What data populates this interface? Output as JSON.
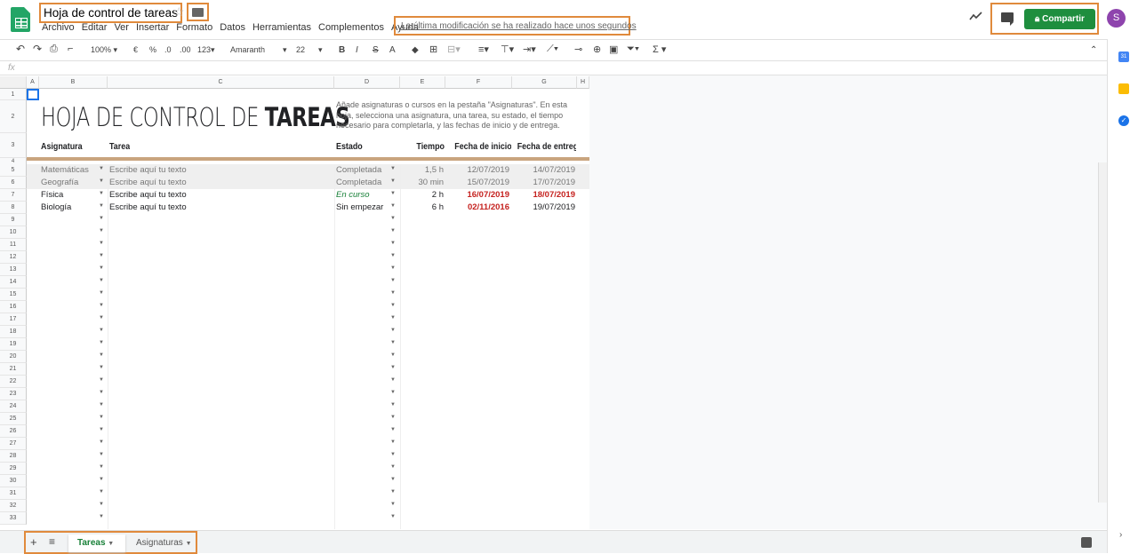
{
  "doc": {
    "title": "Hoja de control de tareas",
    "star": "☆",
    "last_modified": "La última modificación se ha realizado hace unos segundos",
    "share_label": "Compartir",
    "avatar_letter": "S"
  },
  "menu": [
    "Archivo",
    "Editar",
    "Ver",
    "Insertar",
    "Formato",
    "Datos",
    "Herramientas",
    "Complementos",
    "Ayuda"
  ],
  "toolbar": {
    "zoom": "100%",
    "currency": "€",
    "percent": "%",
    "dec_less": ".0",
    "dec_more": ".00",
    "format": "123",
    "font": "Amaranth",
    "font_size": "22",
    "bold": "B",
    "italic": "I",
    "strike": "S",
    "text_color": "A",
    "functions": "Σ"
  },
  "formula_bar": {
    "fx": "fx"
  },
  "columns": [
    "A",
    "B",
    "C",
    "D",
    "E",
    "F",
    "G",
    "H"
  ],
  "rows": [
    "1",
    "2",
    "3",
    "4",
    "5",
    "6",
    "7",
    "8",
    "9",
    "10",
    "11",
    "12",
    "13",
    "14",
    "15",
    "16",
    "17",
    "18",
    "19",
    "20",
    "21",
    "22",
    "23",
    "24",
    "25",
    "26",
    "27",
    "28",
    "29",
    "30",
    "31",
    "32",
    "33"
  ],
  "sheet": {
    "heading_light": "HOJA DE CONTROL DE ",
    "heading_bold": "TAREAS",
    "description": "Añade asignaturas o cursos en la pestaña \"Asignaturas\". En esta hoja, selecciona una asignatura, una tarea, su estado, el tiempo necesario para completarla, y las fechas de inicio y de entrega.",
    "headers": {
      "asignatura": "Asignatura",
      "tarea": "Tarea",
      "estado": "Estado",
      "tiempo": "Tiempo",
      "inicio": "Fecha de inicio",
      "entrega": "Fecha de entrega"
    },
    "tasks": [
      {
        "asignatura": "Matemáticas",
        "tarea": "Escribe aquí tu texto",
        "estado": "Completada",
        "tiempo": "1,5 h",
        "inicio": "12/07/2019",
        "entrega": "14/07/2019"
      },
      {
        "asignatura": "Geografía",
        "tarea": "Escribe aquí tu texto",
        "estado": "Completada",
        "tiempo": "30 min",
        "inicio": "15/07/2019",
        "entrega": "17/07/2019"
      },
      {
        "asignatura": "Física",
        "tarea": "Escribe aquí tu texto",
        "estado": "En curso",
        "tiempo": "2 h",
        "inicio": "16/07/2019",
        "entrega": "18/07/2019"
      },
      {
        "asignatura": "Biología",
        "tarea": "Escribe aquí tu texto",
        "estado": "Sin empezar",
        "tiempo": "6 h",
        "inicio": "02/11/2016",
        "entrega": "19/07/2019"
      }
    ]
  },
  "sheet_tabs": {
    "add": "+",
    "list": "≡",
    "active": "Tareas",
    "other": "Asignaturas"
  },
  "colors": {
    "accent": "#e08a3c",
    "share": "#1e8e3e",
    "overdue": "#c5221f",
    "in_progress": "#188038"
  }
}
